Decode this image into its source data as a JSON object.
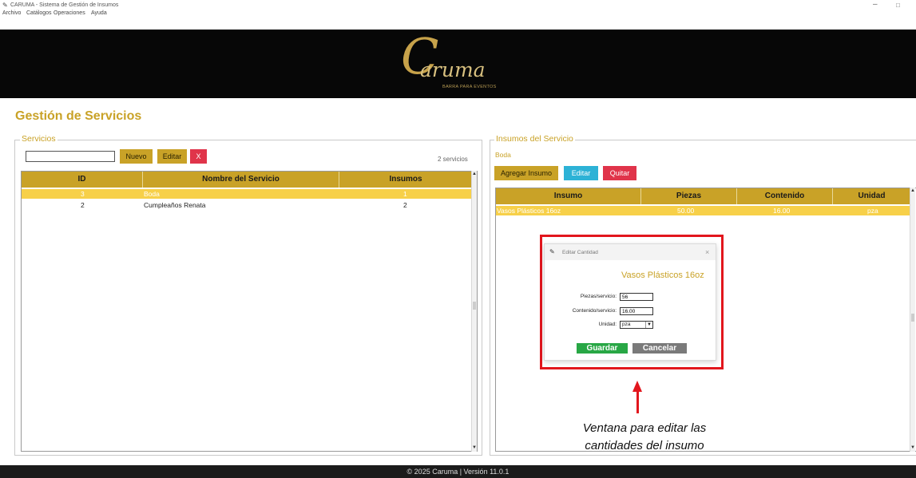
{
  "window": {
    "title": "CARUMA - Sistema de Gestión de Insumos"
  },
  "menu": [
    "Archivo",
    "Catálogos",
    "Operaciones",
    "Ayuda"
  ],
  "logo": {
    "initial": "C",
    "word": "aruma",
    "tagline": "BARRA PARA EVENTOS"
  },
  "page": {
    "title": "Gestión de Servicios"
  },
  "servicios": {
    "legend": "Servicios",
    "search_value": "",
    "buttons": {
      "nuevo": "Nuevo",
      "editar": "Editar",
      "eliminar": "X"
    },
    "count": "2 servicios",
    "columns": [
      "ID",
      "Nombre del Servicio",
      "Insumos"
    ],
    "rows": [
      {
        "id": "3",
        "nombre": "Boda",
        "insumos": "1",
        "selected": true
      },
      {
        "id": "2",
        "nombre": "Cumpleaños Renata",
        "insumos": "2",
        "selected": false
      }
    ]
  },
  "insumos": {
    "legend": "Insumos del Servicio",
    "service_name": "Boda",
    "buttons": {
      "agregar": "Agregar Insumo",
      "editar": "Editar",
      "quitar": "Quitar"
    },
    "columns": [
      "Insumo",
      "Piezas",
      "Contenido",
      "Unidad"
    ],
    "rows": [
      {
        "insumo": "Vasos Plásticos 16oz",
        "piezas": "50.00",
        "contenido": "16.00",
        "unidad": "pza",
        "selected": true
      }
    ]
  },
  "dialog": {
    "title": "Editar Cantidad",
    "close": "×",
    "item_name": "Vasos Plásticos 16oz",
    "piezas_label": "Piezas/servicio:",
    "piezas_value": "56",
    "contenido_label": "Contenido/servicio:",
    "contenido_value": "16.00",
    "unidad_label": "Unidad:",
    "unidad_value": "pza",
    "save_label": "Guardar",
    "cancel_label": "Cancelar"
  },
  "annotation": {
    "line1": "Ventana para editar las",
    "line2": "cantidades del insumo"
  },
  "footer": {
    "text": "© 2025 Caruma | Versión 11.0.1"
  },
  "colors": {
    "accent": "#c9a227",
    "selected_row": "#f7d049",
    "danger": "#e0344a",
    "info": "#2db2d6",
    "success": "#28a745",
    "highlight_border": "#e2161d",
    "banner": "#070707"
  }
}
